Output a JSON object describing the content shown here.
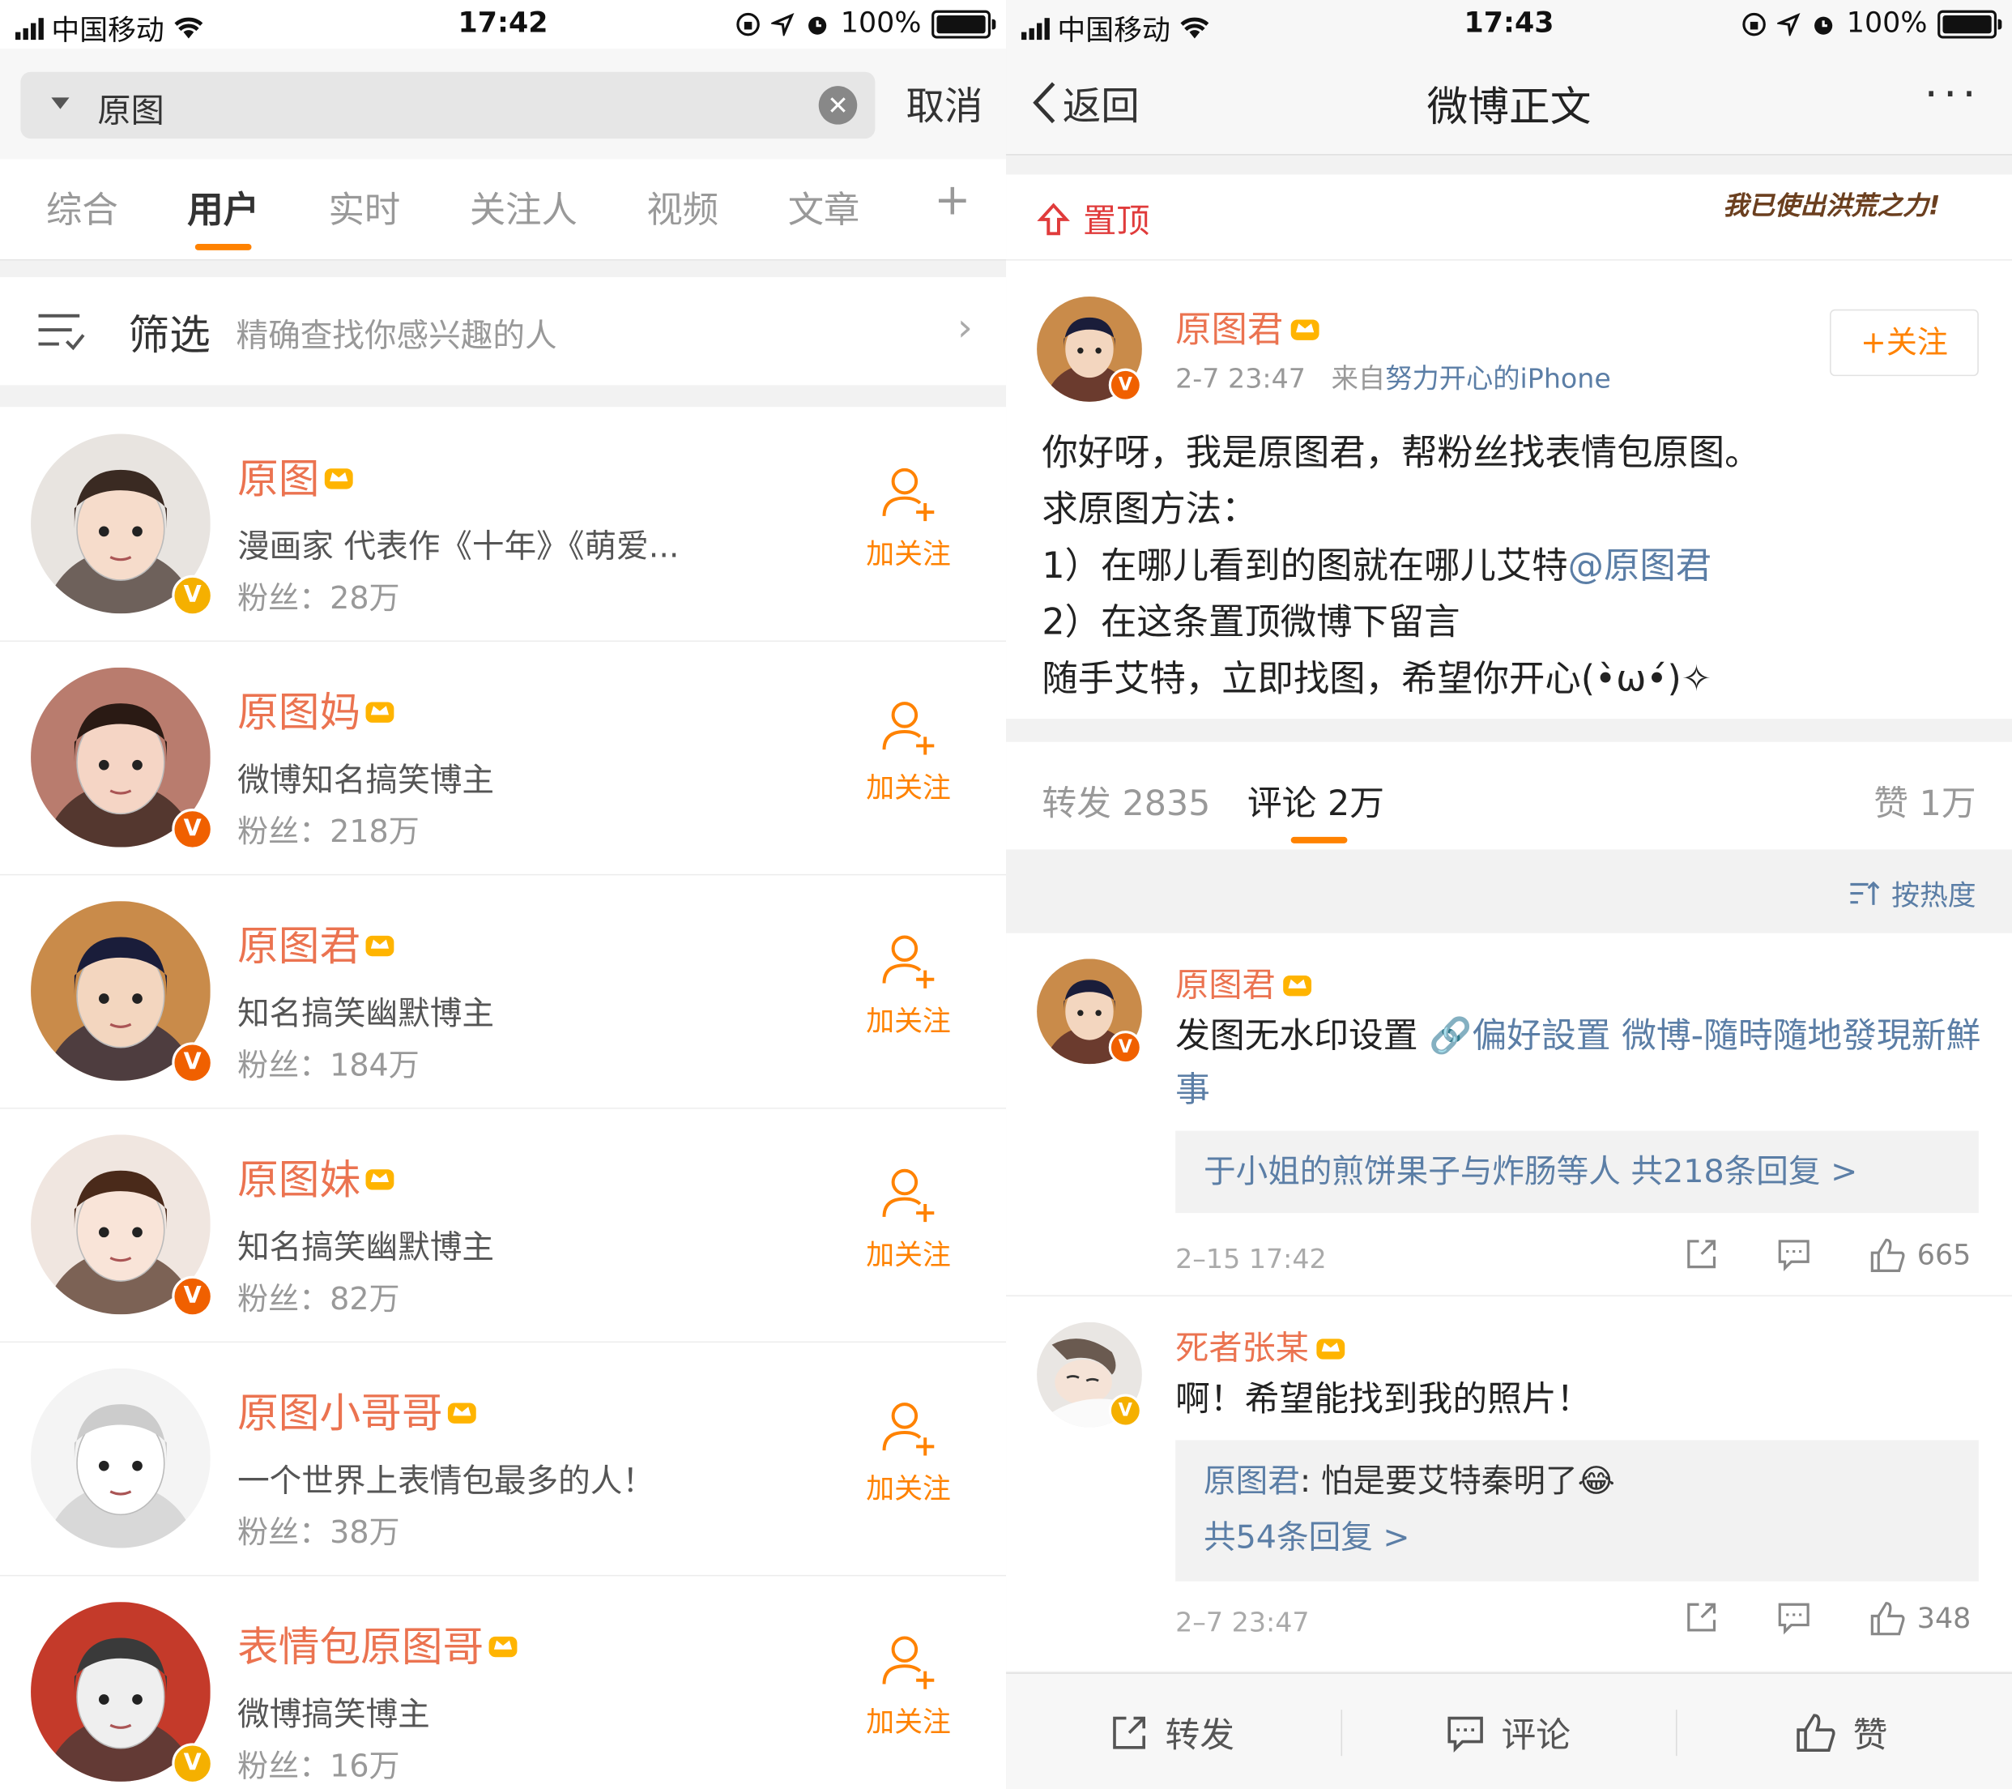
{
  "left": {
    "status": {
      "carrier": "中国移动",
      "time": "17:42",
      "battery": "100%"
    },
    "search": {
      "query": "原图",
      "cancel_label": "取消"
    },
    "tabs": [
      {
        "label": "综合"
      },
      {
        "label": "用户"
      },
      {
        "label": "实时"
      },
      {
        "label": "关注人"
      },
      {
        "label": "视频"
      },
      {
        "label": "文章"
      },
      {
        "label": "+"
      }
    ],
    "active_tab": "用户",
    "filter": {
      "title": "筛选",
      "desc": "精确查找你感兴趣的人"
    },
    "users": [
      {
        "name": "原图",
        "desc": "漫画家 代表作《十年》《萌爱...",
        "fans": "粉丝：28万",
        "follow_label": "加关注",
        "verify": "gold"
      },
      {
        "name": "原图妈",
        "desc": "微博知名搞笑博主",
        "fans": "粉丝：218万",
        "follow_label": "加关注",
        "verify": "red"
      },
      {
        "name": "原图君",
        "desc": "知名搞笑幽默博主",
        "fans": "粉丝：184万",
        "follow_label": "加关注",
        "verify": "red"
      },
      {
        "name": "原图妹",
        "desc": "知名搞笑幽默博主",
        "fans": "粉丝：82万",
        "follow_label": "加关注",
        "verify": "red"
      },
      {
        "name": "原图小哥哥",
        "desc": "一个世界上表情包最多的人！",
        "fans": "粉丝：38万",
        "follow_label": "加关注",
        "verify": "none"
      },
      {
        "name": "表情包原图哥",
        "desc": "微博搞笑博主",
        "fans": "粉丝：16万",
        "follow_label": "加关注",
        "verify": "gold"
      }
    ]
  },
  "right": {
    "status": {
      "carrier": "中国移动",
      "time": "17:43",
      "battery": "100%"
    },
    "nav": {
      "back_label": "返回",
      "title": "微博正文",
      "more": "···"
    },
    "pin": {
      "label": "置顶",
      "slogan": "我已使出洪荒之力!"
    },
    "post": {
      "author": "原图君",
      "time": "2-7 23:47",
      "source_prefix": "来自",
      "source": "努力开心的iPhone",
      "follow_label": "+关注",
      "lines": [
        "你好呀，我是原图君，帮粉丝找表情包原图。",
        "求原图方法：",
        "1）在哪儿看到的图就在哪儿艾特",
        "2）在这条置顶微博下留言",
        "随手艾特，立即找图，希望你开心(•̀ω•́)✧"
      ],
      "mention": "@原图君"
    },
    "stats": {
      "repost": "转发 2835",
      "comment": "评论 2万",
      "like": "赞 1万"
    },
    "sort_label": "按热度",
    "comments": [
      {
        "author": "原图君",
        "text": "发图无水印设置",
        "link": "🔗偏好設置 微博-隨時隨地發現新鮮事",
        "reply_summary": "于小姐的煎饼果子与炸肠等人",
        "reply_count": "共218条回复 >",
        "time": "2–15 17:42",
        "likes": "665"
      },
      {
        "author": "死者张某",
        "text": "啊！希望能找到我的照片！",
        "reply_author": "原图君",
        "reply_text": ": 怕是要艾特秦明了😂",
        "reply_count": "共54条回复 >",
        "time": "2–7 23:47",
        "likes": "348"
      }
    ],
    "bottom": {
      "repost": "转发",
      "comment": "评论",
      "like": "赞"
    }
  }
}
